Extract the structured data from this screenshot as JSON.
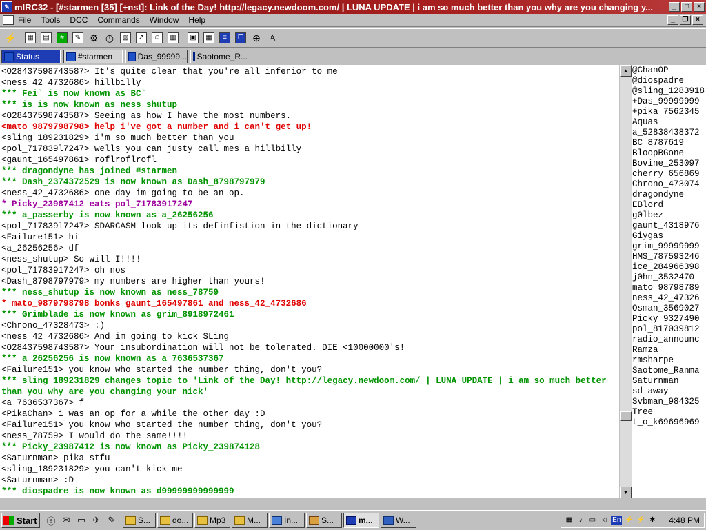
{
  "window": {
    "title": "mIRC32 - [#starmen [35] [+nst]: Link of the Day! http://legacy.newdoom.com/ | LUNA UPDATE | i am so much better than you why are you changing y...",
    "app_icon": "mirc-icon",
    "minimize": "_",
    "maximize": "□",
    "close": "×"
  },
  "menubar": {
    "items": [
      "File",
      "Tools",
      "DCC",
      "Commands",
      "Window",
      "Help"
    ],
    "mdi_minimize": "_",
    "mdi_restore": "❐",
    "mdi_close": "×"
  },
  "toolbar": {
    "icons": [
      "connect-icon",
      "options-icon",
      "server-list-icon",
      "channel-folder-icon",
      "script-editor-icon",
      "channels-list-icon",
      "timer-icon",
      "colors-icon",
      "dcc-send-icon",
      "dcc-chat-icon",
      "dcc-options-icon",
      "notify-list-icon",
      "urls-icon",
      "tile-icon",
      "cascade-icon",
      "help-icon",
      "about-icon"
    ]
  },
  "switchbar": {
    "tabs": [
      {
        "label": "Status",
        "state": "active"
      },
      {
        "label": "#starmen",
        "state": "pressed"
      },
      {
        "label": "Das_99999...",
        "state": "normal"
      },
      {
        "label": "Saotome_R...",
        "state": "normal"
      }
    ]
  },
  "chat": {
    "lines": [
      {
        "text": "<O28437598743587> It's quite clear that you're all inferior to me",
        "color": "black"
      },
      {
        "text": "<ness_42_4732686> hillbilly",
        "color": "black"
      },
      {
        "text": "*** Fei` is now known as BC`",
        "color": "green"
      },
      {
        "text": "*** is is now known as ness_shutup",
        "color": "green"
      },
      {
        "text": "<O28437598743587> Seeing as how I have the most numbers.",
        "color": "black"
      },
      {
        "text": "<mato_9879798798> help i've got a number and i can't get up!",
        "color": "red"
      },
      {
        "text": "<sling_189231829> i'm so much better than you",
        "color": "black"
      },
      {
        "text": "<pol_717839l7247> wells you can justy call mes a hillbilly",
        "color": "black"
      },
      {
        "text": "<gaunt_165497861> roflroflrofl",
        "color": "black"
      },
      {
        "text": "*** dragondyne has joined #starmen",
        "color": "green"
      },
      {
        "text": "*** Dash_2374372529 is now known as Dash_8798797979",
        "color": "green"
      },
      {
        "text": "<ness_42_4732686> one day im going to be an op.",
        "color": "black"
      },
      {
        "text": "* Picky_23987412 eats pol_71783917247",
        "color": "purple"
      },
      {
        "text": "*** a_passerby is now known as a_26256256",
        "color": "green"
      },
      {
        "text": "<pol_717839l7247> SDARCASM look up its definfistion in the dictionary",
        "color": "black"
      },
      {
        "text": "<Failure151> hi",
        "color": "black"
      },
      {
        "text": "<a_26256256> df",
        "color": "black"
      },
      {
        "text": "<ness_shutup> So will I!!!!",
        "color": "black"
      },
      {
        "text": "<pol_71783917247> oh nos",
        "color": "black"
      },
      {
        "text": "<Dash_8798797979> my numbers are higher than yours!",
        "color": "black"
      },
      {
        "text": "*** ness_shutup is now known as ness_78759",
        "color": "green"
      },
      {
        "text": "* mato_9879798798 bonks gaunt_165497861 and ness_42_4732686",
        "color": "red"
      },
      {
        "text": "*** Grimblade is now known as grim_8918972461",
        "color": "green"
      },
      {
        "text": "<Chrono_47328473> :)",
        "color": "black"
      },
      {
        "text": "<ness_42_4732686> And im going to kick SLing",
        "color": "black"
      },
      {
        "text": "<O28437598743587> Your insubordination will not be tolerated. DIE <10000000's!",
        "color": "black"
      },
      {
        "text": "*** a_26256256 is now known as a_7636537367",
        "color": "green"
      },
      {
        "text": "<Failure151> you know who started the number thing, don't you?",
        "color": "black"
      },
      {
        "text": "*** sling_189231829 changes topic to 'Link of the Day! http://legacy.newdoom.com/ | LUNA UPDATE | i am so much better than you why are you changing your nick'",
        "color": "green"
      },
      {
        "text": "<a_7636537367> f",
        "color": "black"
      },
      {
        "text": "<PikaChan> i was an op for a while the other day :D",
        "color": "black"
      },
      {
        "text": "<Failure151> you know who started the number thing, don't you?",
        "color": "black"
      },
      {
        "text": "<ness_78759> I would do the same!!!!",
        "color": "black"
      },
      {
        "text": "*** Picky_23987412 is now known as Picky_239874128",
        "color": "green"
      },
      {
        "text": "<Saturnman> pika stfu",
        "color": "black"
      },
      {
        "text": "<sling_189231829> you can't kick me",
        "color": "black"
      },
      {
        "text": "<Saturnman> :D",
        "color": "black"
      },
      {
        "text": "*** diospadre is now known as d99999999999999",
        "color": "green"
      }
    ]
  },
  "nicklist": {
    "nicks": [
      "@ChanOP",
      "@diospadre",
      "@sling_1283918",
      "+Das_99999999",
      "+pika_7562345",
      "Aquas",
      "a_52838438372",
      "BC_8787619",
      "BloopBGone",
      "Bovine_253097",
      "cherry_656869",
      "Chrono_473074",
      "dragondyne",
      "EBlord",
      "g0lbez",
      "gaunt_4318976",
      "Giygas",
      "grim_99999999",
      "HMS_787593246",
      "ice_284966398",
      "j0hn_3532470",
      "mato_98798789",
      "ness_42_47326",
      "Osman_3569027",
      "Picky_9327490",
      "pol_817039812",
      "radio_announc",
      "Ramza",
      "rmsharpe",
      "Saotome_Ranma",
      "Saturnman",
      "sd-away",
      "Svbman_984325",
      "Tree",
      "t_o_k69696969"
    ]
  },
  "taskbar": {
    "start_label": "Start",
    "quicklaunch": [
      "internet-explorer-icon",
      "outlook-icon",
      "show-desktop-icon",
      "launch-icon",
      "notepad-icon"
    ],
    "tasks": [
      {
        "label": "S...",
        "active": false
      },
      {
        "label": "do...",
        "active": false
      },
      {
        "label": "Mp3",
        "active": false
      },
      {
        "label": "M...",
        "active": false
      },
      {
        "label": "In...",
        "active": false
      },
      {
        "label": "S...",
        "active": false
      },
      {
        "label": "m...",
        "active": true
      },
      {
        "label": "W...",
        "active": false
      }
    ],
    "tray_icons": [
      "network-icon",
      "volume-icon",
      "monitor-icon",
      "speaker-icon",
      "language-icon",
      "winamp-icon",
      "power-icon",
      "antivirus-icon"
    ],
    "language": "En",
    "clock": "4:48 PM"
  }
}
